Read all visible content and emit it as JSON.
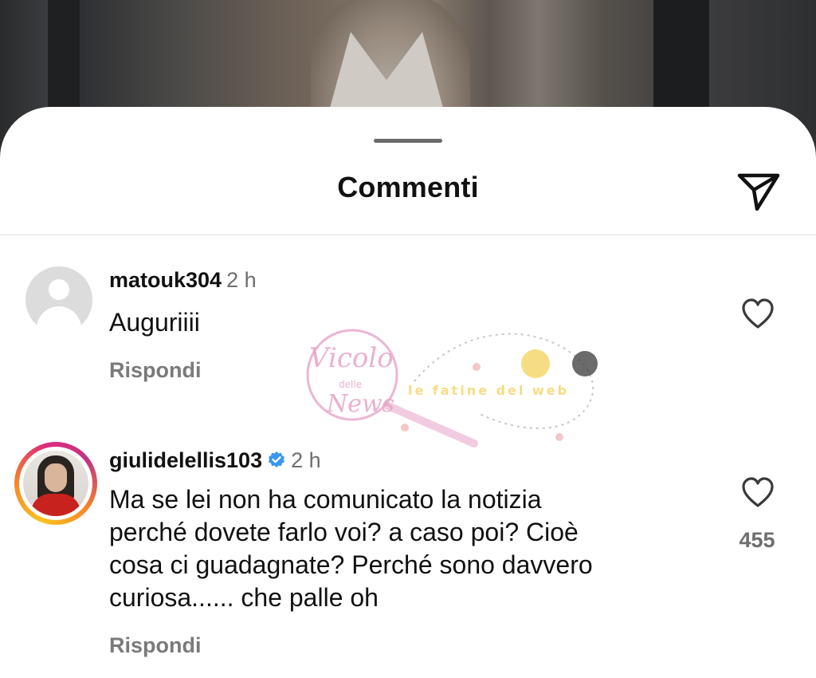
{
  "sheet": {
    "title": "Commenti"
  },
  "comments": [
    {
      "username": "matouk304",
      "time": "2 h",
      "text": "Auguriiii",
      "reply_label": "Rispondi",
      "like_count": "",
      "verified": false
    },
    {
      "username": "giulidelellis103",
      "time": "2 h",
      "text": "Ma se lei non ha comunicato la notizia\nperché dovete farlo voi? a caso poi? Cioè\ncosa ci guadagnate? Perché sono davvero\ncuriosa...... che palle oh",
      "reply_label": "Rispondi",
      "like_count": "455",
      "verified": true
    }
  ],
  "watermark": {
    "brand_main": "Vicolo",
    "brand_small": "delle",
    "brand_end": "News",
    "secondary": "le fatine del web"
  },
  "colors": {
    "verified_blue": "#3897f0",
    "text_primary": "#111111",
    "text_secondary": "#6e6e6e",
    "watermark_pink": "#e7a4c8",
    "watermark_yellow": "#f5d76e"
  }
}
